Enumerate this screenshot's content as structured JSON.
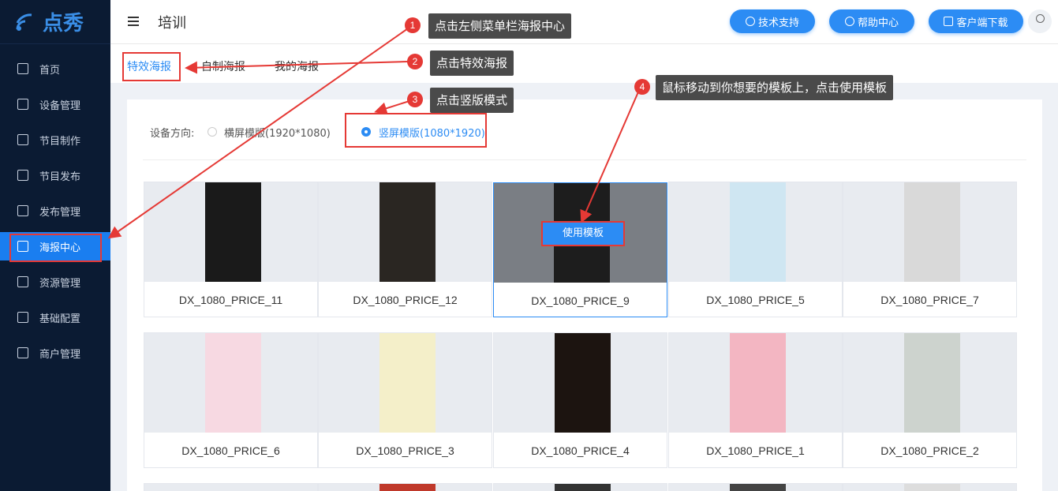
{
  "app": {
    "logo_text": "点秀"
  },
  "sidebar": {
    "items": [
      {
        "label": "首页"
      },
      {
        "label": "设备管理"
      },
      {
        "label": "节目制作"
      },
      {
        "label": "节目发布"
      },
      {
        "label": "发布管理"
      },
      {
        "label": "海报中心",
        "active": true
      },
      {
        "label": "资源管理"
      },
      {
        "label": "基础配置"
      },
      {
        "label": "商户管理"
      }
    ]
  },
  "header": {
    "title": "培训",
    "buttons": [
      {
        "label": "技术支持",
        "icon": "support-icon"
      },
      {
        "label": "帮助中心",
        "icon": "help-icon"
      },
      {
        "label": "客户端下载",
        "icon": "phone-icon"
      }
    ]
  },
  "tabs": [
    {
      "label": "特效海报",
      "active": true
    },
    {
      "label": "自制海报"
    },
    {
      "label": "我的海报"
    }
  ],
  "orientation": {
    "label": "设备方向:",
    "options": [
      {
        "label": "横屏模版(1920*1080)",
        "selected": false
      },
      {
        "label": "竖屏模版(1080*1920)",
        "selected": true
      }
    ]
  },
  "templates": [
    {
      "name": "DX_1080_PRICE_11",
      "color": "#1a1a1a"
    },
    {
      "name": "DX_1080_PRICE_12",
      "color": "#2a2622"
    },
    {
      "name": "DX_1080_PRICE_9",
      "color": "#1d1d1d",
      "hover": true
    },
    {
      "name": "DX_1080_PRICE_5",
      "color": "#cfe6f2"
    },
    {
      "name": "DX_1080_PRICE_7",
      "color": "#d9d9d9"
    },
    {
      "name": "DX_1080_PRICE_6",
      "color": "#f7d9e2"
    },
    {
      "name": "DX_1080_PRICE_3",
      "color": "#f4efc9"
    },
    {
      "name": "DX_1080_PRICE_4",
      "color": "#1c1410"
    },
    {
      "name": "DX_1080_PRICE_1",
      "color": "#f3b6c2"
    },
    {
      "name": "DX_1080_PRICE_2",
      "color": "#cdd3ce"
    }
  ],
  "use_template_label": "使用模板",
  "annotations": [
    {
      "num": "1",
      "text": "点击左侧菜单栏海报中心"
    },
    {
      "num": "2",
      "text": "点击特效海报"
    },
    {
      "num": "3",
      "text": "点击竖版模式"
    },
    {
      "num": "4",
      "text": "鼠标移动到你想要的模板上，点击使用模板"
    }
  ],
  "colors": {
    "sidebar_bg": "#0b1b33",
    "accent": "#2c8cf4",
    "annotation_red": "#e53935"
  }
}
